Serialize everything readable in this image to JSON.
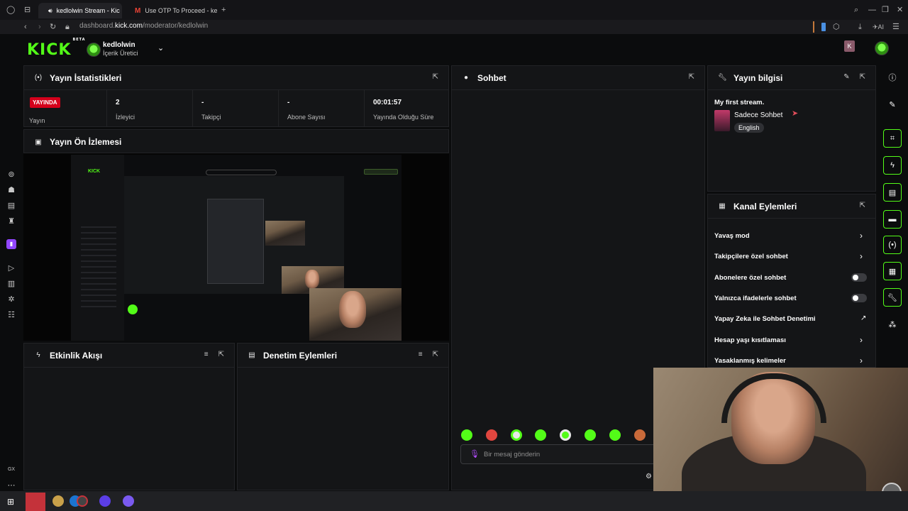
{
  "browser": {
    "tabs": [
      {
        "title": "kedlolwin Stream - Kic",
        "active": true
      },
      {
        "title": "Use OTP To Proceed - ke",
        "active": false
      }
    ],
    "url_prefix": "dashboard.",
    "url_domain": "kick.com",
    "url_path": "/moderator/kedlolwin",
    "profile_letter": "K",
    "ai_label": "AI",
    "gx_label": "GX"
  },
  "header": {
    "logo": "KICK",
    "logo_badge": "BETA",
    "username": "kedlolwin",
    "role": "İçerik Üretici"
  },
  "stats_panel": {
    "title": "Yayın İstatistikleri",
    "live_badge": "YAYINDA",
    "items": [
      {
        "value": "",
        "label": "Yayın"
      },
      {
        "value": "2",
        "label": "İzleyici"
      },
      {
        "value": "-",
        "label": "Takipçi"
      },
      {
        "value": "-",
        "label": "Abone Sayısı"
      },
      {
        "value": "00:01:57",
        "label": "Yayında Olduğu Süre"
      }
    ]
  },
  "preview_panel": {
    "title": "Yayın Ön İzlemesi"
  },
  "activity_panel": {
    "title": "Etkinlik Akışı"
  },
  "moderation_panel": {
    "title": "Denetim Eylemleri"
  },
  "chat_panel": {
    "title": "Sohbet",
    "input_placeholder": "Bir mesaj gönderin"
  },
  "stream_info_panel": {
    "title": "Yayın bilgisi",
    "stream_title": "My first stream.",
    "category": "Sadece Sohbet",
    "language": "English"
  },
  "channel_actions_panel": {
    "title": "Kanal Eylemleri",
    "items": [
      {
        "label": "Yavaş mod",
        "control": "chevron"
      },
      {
        "label": "Takipçilere özel sohbet",
        "control": "chevron"
      },
      {
        "label": "Abonelere özel sohbet",
        "control": "toggle",
        "on": false
      },
      {
        "label": "Yalnızca ifadelerle sohbet",
        "control": "toggle",
        "on": false
      },
      {
        "label": "Yapay Zeka ile Sohbet Denetimi",
        "control": "external"
      },
      {
        "label": "Hesap yaşı kısıtlaması",
        "control": "chevron"
      },
      {
        "label": "Yasaklanmış kelimeler",
        "control": "chevron"
      }
    ]
  },
  "colors": {
    "brand_green": "#53fc18",
    "live_red": "#d4001b",
    "panel_bg": "#141517"
  }
}
